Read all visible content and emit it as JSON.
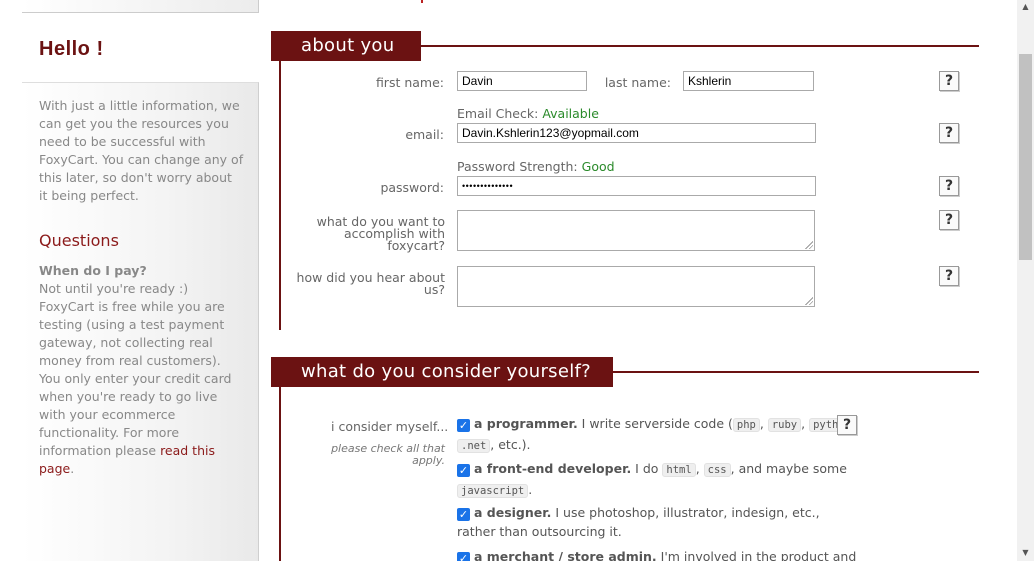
{
  "sidebar": {
    "hello": "Hello !",
    "intro": "With just a little information, we can get you the resources you need to be successful with FoxyCart. You can change any of this later, so don't worry about it being perfect.",
    "questions_title": "Questions",
    "faq_question": "When do I pay?",
    "faq_answer": "Not until you're ready :) FoxyCart is free while you are testing (using a test payment gateway, not collecting real money from real customers). You only enter your credit card when you're ready to go live with your ecommerce functionality. For more information please",
    "faq_link": "read this page",
    "faq_end": "."
  },
  "about": {
    "title": "about you",
    "first_name_label": "first name:",
    "first_name_value": "Davin",
    "last_name_label": "last name:",
    "last_name_value": "Kshlerin",
    "email_check_label": "Email Check:",
    "email_check_value": "Available",
    "email_label": "email:",
    "email_value": "Davin.Kshlerin123@yopmail.com",
    "password_strength_label": "Password Strength:",
    "password_strength_value": "Good",
    "password_label": "password:",
    "password_value": "••••••••••••••",
    "accomplish_label": "what do you want to accomplish with foxycart?",
    "hear_label": "how did you hear about us?",
    "help": "?"
  },
  "consider": {
    "title": "what do you consider yourself?",
    "label": "i consider myself...",
    "note": "please check all that apply.",
    "options": [
      {
        "bold": "a programmer.",
        "text_1": " I write serverside code (",
        "c1": "php",
        "sep1": ", ",
        "c2": "ruby",
        "sep2": ", ",
        "c3": "python",
        "sep3": ", ",
        "c4": ".net",
        "text_2": ", etc.)."
      },
      {
        "bold": "a front-end developer.",
        "text_1": " I do ",
        "c1": "html",
        "sep1": ", ",
        "c2": "css",
        "text_2": ", and maybe some ",
        "c3": "javascript",
        "text_3": "."
      },
      {
        "bold": "a designer.",
        "text_1": " I use photoshop, illustrator, indesign, etc., rather than outsourcing it."
      },
      {
        "bold": "a merchant / store admin.",
        "text_1": " I'm involved in the product and"
      }
    ]
  },
  "scrollbar": {
    "up": "▲",
    "down": "▼"
  }
}
